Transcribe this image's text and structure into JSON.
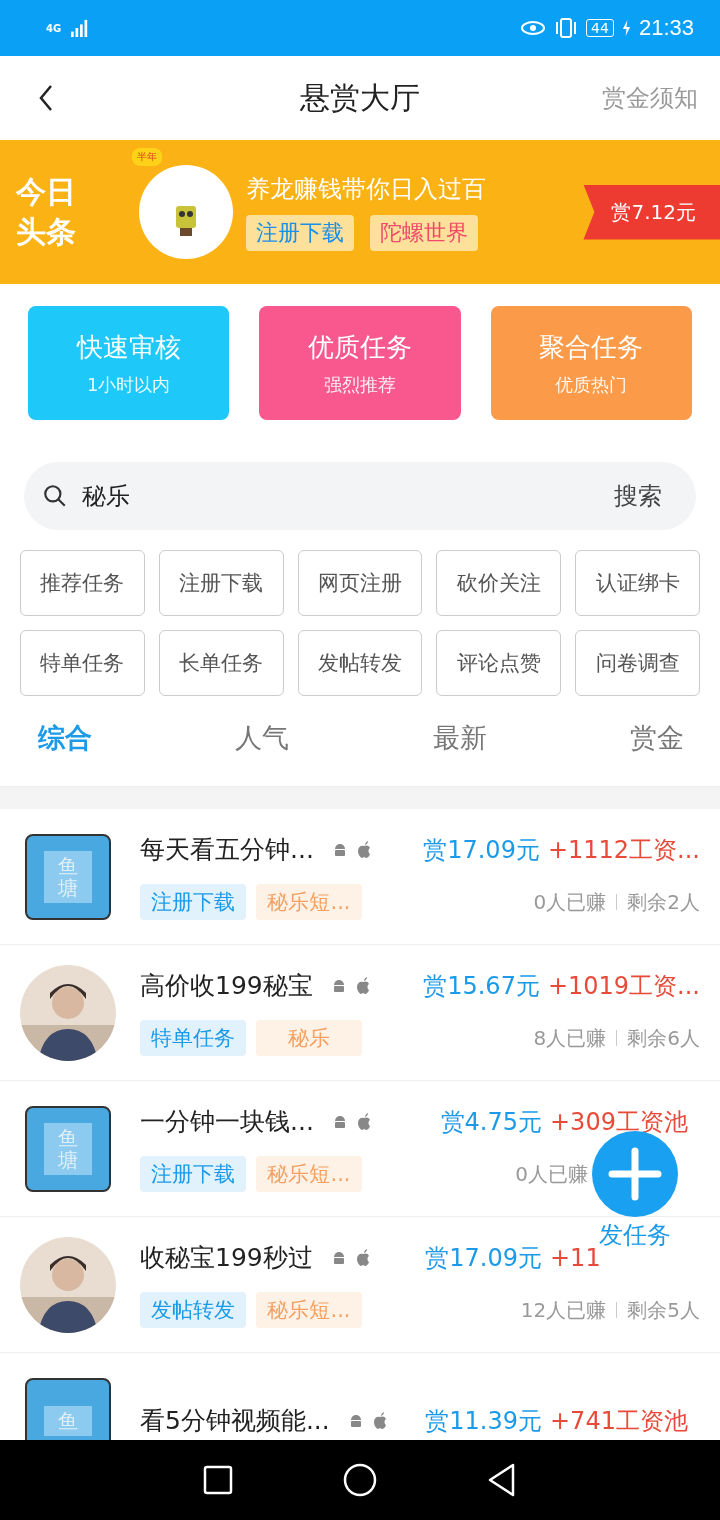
{
  "status_bar": {
    "network": "4G",
    "battery": "44",
    "time": "21:33"
  },
  "header": {
    "title": "悬赏大厅",
    "action": "赏金须知"
  },
  "headline": {
    "logo": [
      "今日",
      "头条"
    ],
    "crown_badge": "半年",
    "title": "养龙赚钱带你日入过百",
    "tags": [
      {
        "label": "注册下载",
        "kind": "type"
      },
      {
        "label": "陀螺世界",
        "kind": "app"
      }
    ],
    "reward": "赏7.12元"
  },
  "categories": [
    {
      "title": "快速审核",
      "subtitle": "1小时以内",
      "color": "#1ec8f8"
    },
    {
      "title": "优质任务",
      "subtitle": "强烈推荐",
      "color": "#f8588e"
    },
    {
      "title": "聚合任务",
      "subtitle": "优质热门",
      "color": "#fb9a48"
    }
  ],
  "search": {
    "value": "秘乐",
    "button": "搜索"
  },
  "filters": [
    "推荐任务",
    "注册下载",
    "网页注册",
    "砍价关注",
    "认证绑卡",
    "特单任务",
    "长单任务",
    "发帖转发",
    "评论点赞",
    "问卷调查"
  ],
  "sort_tabs": [
    {
      "label": "综合",
      "selected": true
    },
    {
      "label": "人气",
      "selected": false
    },
    {
      "label": "最新",
      "selected": false
    },
    {
      "label": "赏金",
      "selected": false
    }
  ],
  "tasks": [
    {
      "avatar": {
        "kind": "pond",
        "text": "鱼塘"
      },
      "title": "每天看五分钟...",
      "reward": "赏17.09元",
      "pool": "+1112工资...",
      "tags": [
        "注册下载",
        "秘乐短..."
      ],
      "earned": "0人已赚",
      "remaining": "剩余2人"
    },
    {
      "avatar": {
        "kind": "picture"
      },
      "title": "高价收199秘宝",
      "reward": "赏15.67元",
      "pool": "+1019工资...",
      "tags": [
        "特单任务",
        "秘乐"
      ],
      "earned": "8人已赚",
      "remaining": "剩余6人"
    },
    {
      "avatar": {
        "kind": "pond",
        "text": "鱼塘"
      },
      "title": "一分钟一块钱...",
      "reward": "赏4.75元",
      "pool": "+309工资池",
      "tags": [
        "注册下载",
        "秘乐短..."
      ],
      "earned": "0人已赚"
    },
    {
      "avatar": {
        "kind": "picture"
      },
      "title": "收秘宝199秒过",
      "reward": "赏17.09元",
      "pool": "+11",
      "tags": [
        "发帖转发",
        "秘乐短..."
      ],
      "earned": "12人已赚",
      "remaining": "剩余5人"
    },
    {
      "avatar": {
        "kind": "pond",
        "text": "鱼"
      },
      "title": "看5分钟视频能...",
      "reward": "赏11.39元",
      "pool": "+741工资池"
    }
  ],
  "fab": {
    "label": "发任务"
  }
}
